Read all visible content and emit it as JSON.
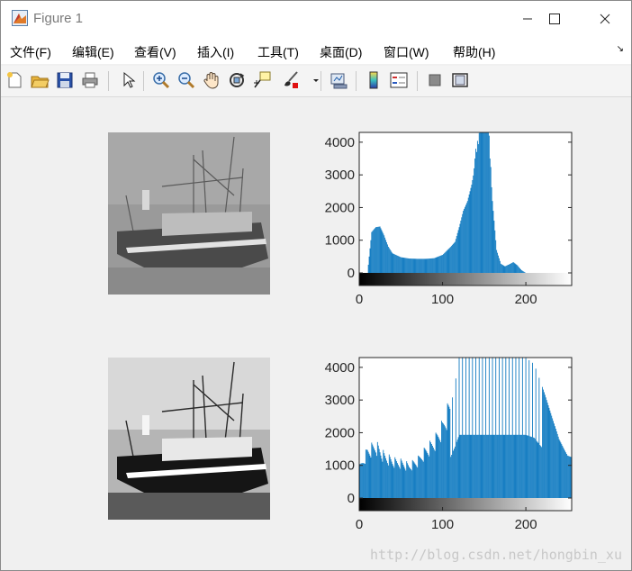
{
  "window": {
    "title": "Figure 1",
    "controls": {
      "minimize": "minimize-icon",
      "maximize": "maximize-icon",
      "close": "close-icon"
    }
  },
  "menu": {
    "items": [
      "文件(F)",
      "编辑(E)",
      "查看(V)",
      "插入(I)",
      "工具(T)",
      "桌面(D)",
      "窗口(W)",
      "帮助(H)"
    ]
  },
  "toolbar": {
    "icons": [
      "new-figure-icon",
      "open-file-icon",
      "save-icon",
      "print-icon",
      "select-arrow-icon",
      "zoom-in-icon",
      "zoom-out-icon",
      "pan-hand-icon",
      "rotate-3d-icon",
      "data-cursor-icon",
      "brush-icon",
      "link-plot-icon",
      "colorbar-icon",
      "legend-icon",
      "hide-plot-tools-icon",
      "show-plot-tools-icon"
    ]
  },
  "colors": {
    "bar": "#0072BD",
    "axes": "#262626",
    "background": "#F0F0F0"
  },
  "chart_data": [
    {
      "type": "histogram",
      "description_of_panel": "upper",
      "xlim": [
        0,
        255
      ],
      "ylim": [
        0,
        4300
      ],
      "xticks": [
        0,
        100,
        200
      ],
      "yticks": [
        0,
        1000,
        2000,
        3000,
        4000
      ],
      "colorbar": "grayscale",
      "x": [
        10,
        15,
        20,
        25,
        30,
        35,
        40,
        50,
        60,
        70,
        80,
        90,
        100,
        110,
        115,
        120,
        125,
        130,
        135,
        140,
        145,
        150,
        155,
        160,
        165,
        170,
        175,
        180,
        185,
        190,
        195,
        200
      ],
      "values": [
        0,
        1250,
        1400,
        1420,
        1150,
        800,
        600,
        480,
        440,
        430,
        430,
        450,
        550,
        800,
        950,
        1400,
        1900,
        2200,
        2700,
        3400,
        4300,
        4300,
        4300,
        2200,
        700,
        280,
        200,
        260,
        330,
        230,
        80,
        0
      ]
    },
    {
      "type": "histogram",
      "description_of_panel": "lower",
      "xlim": [
        0,
        255
      ],
      "ylim": [
        0,
        4300
      ],
      "xticks": [
        0,
        100,
        200
      ],
      "yticks": [
        0,
        1000,
        2000,
        3000,
        4000
      ],
      "colorbar": "grayscale",
      "x": [
        0,
        10,
        20,
        30,
        40,
        50,
        60,
        70,
        80,
        90,
        100,
        110,
        115,
        120,
        130,
        140,
        150,
        160,
        170,
        180,
        190,
        200,
        210,
        220,
        230,
        240,
        250,
        255
      ],
      "values": [
        850,
        1400,
        1550,
        1250,
        1100,
        1050,
        950,
        1100,
        1400,
        1650,
        2100,
        2800,
        3500,
        4300,
        4300,
        4300,
        4300,
        4300,
        4300,
        4300,
        4300,
        4300,
        4100,
        3400,
        2600,
        1800,
        1300,
        1250
      ]
    }
  ],
  "watermark": "http://blog.csdn.net/hongbin_xu"
}
